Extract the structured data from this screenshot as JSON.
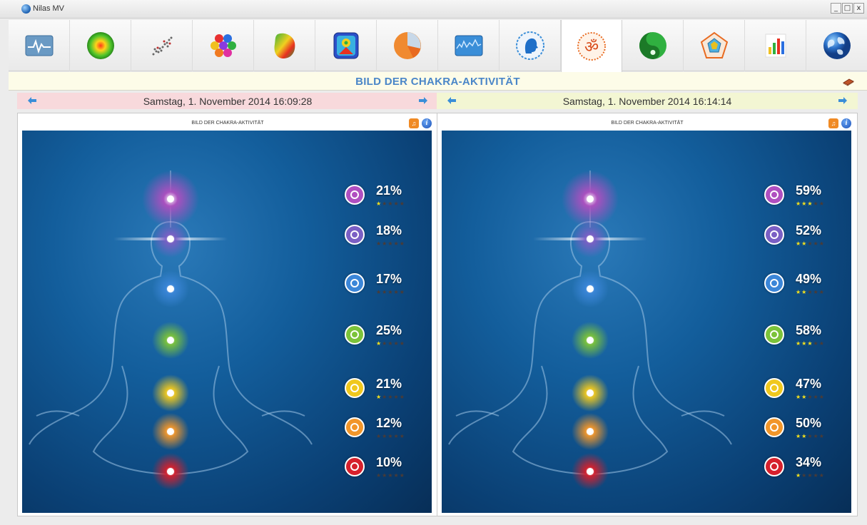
{
  "window": {
    "title": "Nilas MV",
    "minimize": "_",
    "maximize": "□",
    "close": "x"
  },
  "toolbar": {
    "tools": [
      {
        "icon": "heart-rhythm-icon"
      },
      {
        "icon": "energy-sphere-icon"
      },
      {
        "icon": "scatter-plot-icon"
      },
      {
        "icon": "color-cells-icon"
      },
      {
        "icon": "heat-map-icon"
      },
      {
        "icon": "body-scan-icon"
      },
      {
        "icon": "pie-chart-icon"
      },
      {
        "icon": "waveform-icon"
      },
      {
        "icon": "head-profile-icon"
      },
      {
        "icon": "om-symbol-icon",
        "active": true
      },
      {
        "icon": "yin-yang-icon"
      },
      {
        "icon": "pentagon-icon"
      },
      {
        "icon": "bar-chart-icon"
      },
      {
        "icon": "globe-icon"
      }
    ]
  },
  "header": {
    "title": "BILD DER CHAKRA-AKTIVITÄT"
  },
  "panels": [
    {
      "date": "Samstag, 1. November 2014 16:09:28",
      "frame_title": "BILD DER CHAKRA-AKTIVITÄT",
      "chakras": [
        {
          "name": "crown",
          "color": "#b04fc0",
          "percent": "21%",
          "stars": 1
        },
        {
          "name": "third-eye",
          "color": "#7b5fc4",
          "percent": "18%",
          "stars": 0
        },
        {
          "name": "throat",
          "color": "#3b86d8",
          "percent": "17%",
          "stars": 0
        },
        {
          "name": "heart",
          "color": "#7cc33a",
          "percent": "25%",
          "stars": 1
        },
        {
          "name": "solar-plexus",
          "color": "#f0c81e",
          "percent": "21%",
          "stars": 1
        },
        {
          "name": "sacral",
          "color": "#f2962a",
          "percent": "12%",
          "stars": 0
        },
        {
          "name": "root",
          "color": "#d6202c",
          "percent": "10%",
          "stars": 0
        }
      ]
    },
    {
      "date": "Samstag, 1. November 2014 16:14:14",
      "frame_title": "BILD DER CHAKRA-AKTIVITÄT",
      "chakras": [
        {
          "name": "crown",
          "color": "#b04fc0",
          "percent": "59%",
          "stars": 3
        },
        {
          "name": "third-eye",
          "color": "#7b5fc4",
          "percent": "52%",
          "stars": 2
        },
        {
          "name": "throat",
          "color": "#3b86d8",
          "percent": "49%",
          "stars": 2
        },
        {
          "name": "heart",
          "color": "#7cc33a",
          "percent": "58%",
          "stars": 3
        },
        {
          "name": "solar-plexus",
          "color": "#f0c81e",
          "percent": "47%",
          "stars": 2
        },
        {
          "name": "sacral",
          "color": "#f2962a",
          "percent": "50%",
          "stars": 2
        },
        {
          "name": "root",
          "color": "#d6202c",
          "percent": "34%",
          "stars": 1
        }
      ]
    }
  ],
  "colors": {
    "title_blue": "#4a86c8",
    "left_datebar": "#f8d9dc",
    "right_datebar": "#f3f6d3"
  }
}
